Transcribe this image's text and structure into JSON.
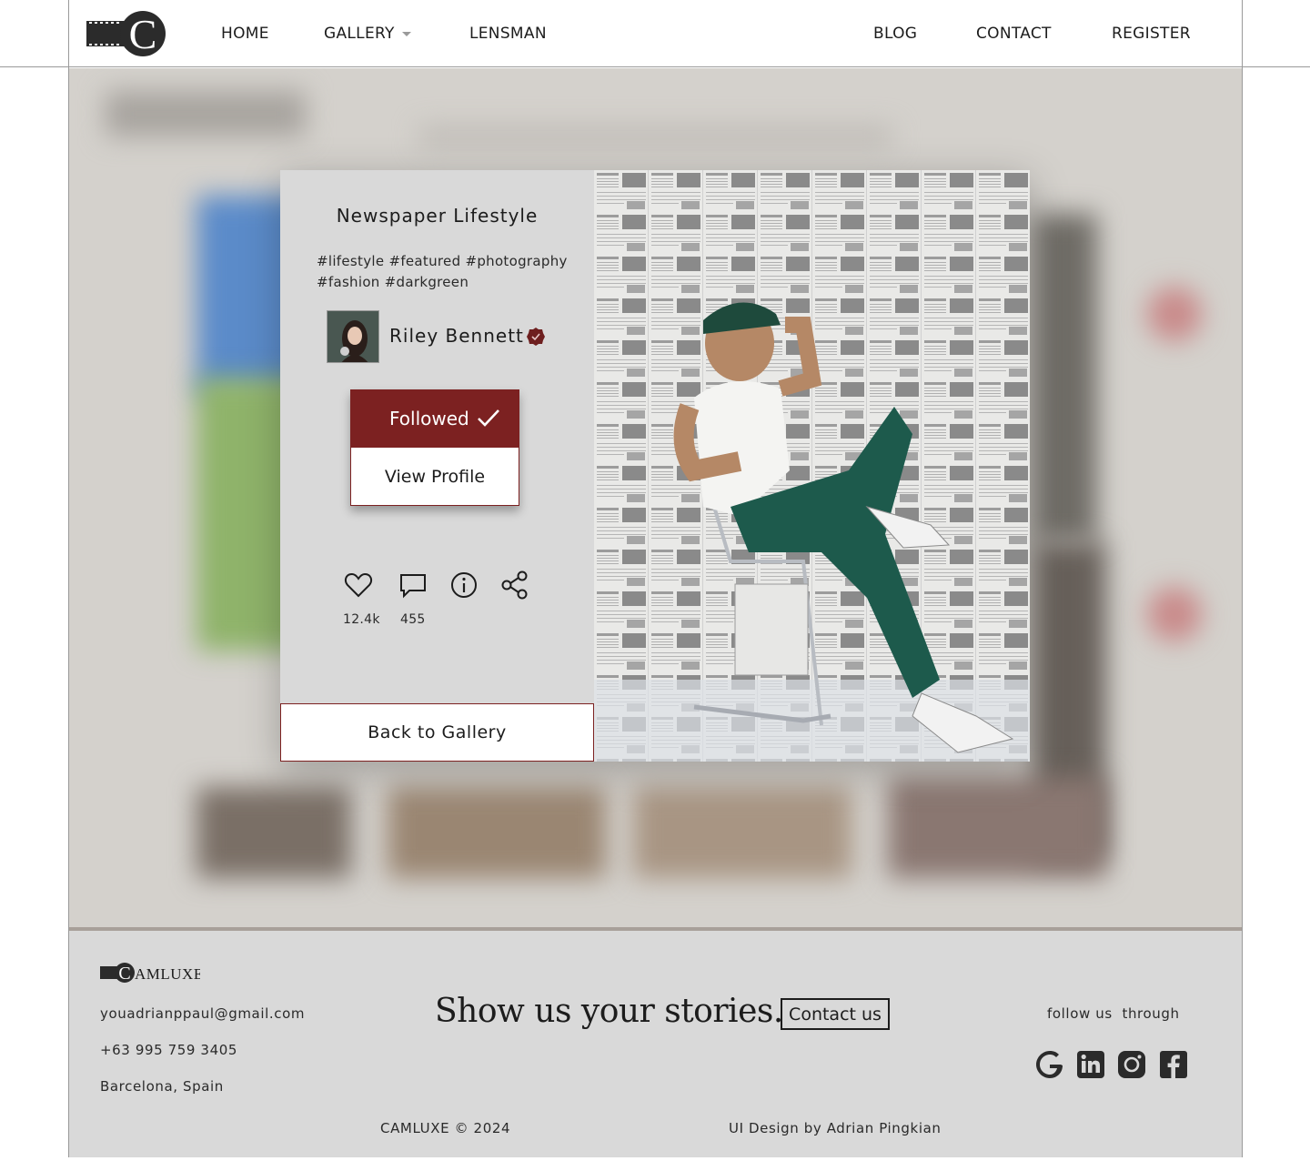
{
  "header": {
    "logo_letter": "C",
    "nav": {
      "home": "HOME",
      "gallery": "GALLERY",
      "lensman": "LENSMAN",
      "blog": "BLOG",
      "contact": "CONTACT",
      "register": "REGISTER"
    }
  },
  "modal": {
    "title": "Newspaper Lifestyle",
    "tags_line1": "#lifestyle #featured #photography",
    "tags_line2": "#fashion #darkgreen",
    "author": {
      "name": "Riley Bennett",
      "verified_icon": "verified-badge-icon"
    },
    "followed_label": "Followed",
    "view_profile_label": "View Profile",
    "likes": "12.4k",
    "comments": "455",
    "back_label": "Back to Gallery",
    "icons": [
      "heart-icon",
      "comment-icon",
      "info-icon",
      "share-icon"
    ]
  },
  "footer": {
    "brand": "CAMLUXE",
    "email": "youadrianppaul@gmail.com",
    "phone": "+63 995 759 3405",
    "location": "Barcelona, Spain",
    "headline": "Show us your stories.",
    "contact_label": "Contact us",
    "follow_label": "follow us  through",
    "copyright": "CAMLUXE © 2024",
    "credit": "UI Design by Adrian Pingkian",
    "social_icons": [
      "google-icon",
      "linkedin-icon",
      "instagram-icon",
      "facebook-icon"
    ]
  },
  "colors": {
    "accent": "#7c2121",
    "panel": "#d9d9d9",
    "backdrop": "#d4d1cc",
    "footer_border": "#a8a099"
  }
}
